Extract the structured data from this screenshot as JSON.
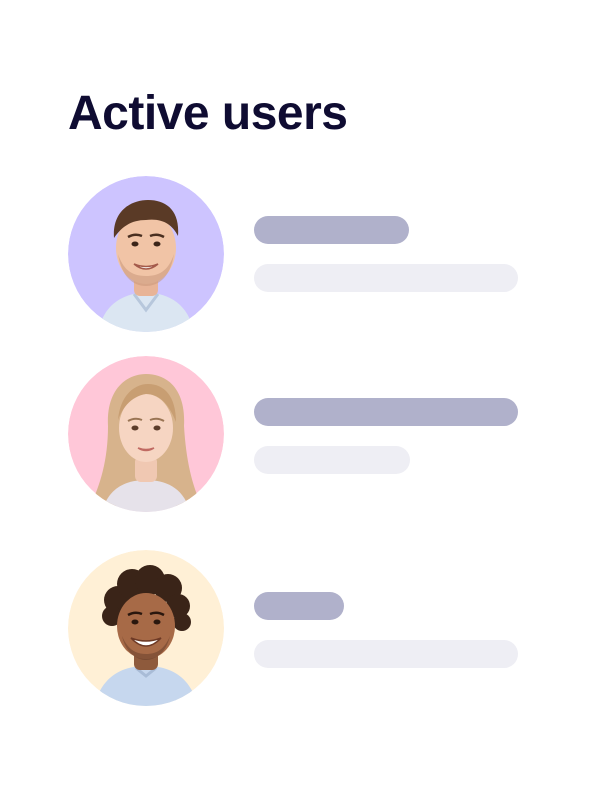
{
  "header": {
    "title": "Active users"
  },
  "users": [
    {
      "avatar_bg": "#cdc4ff",
      "avatar_icon": "user-avatar-man-icon"
    },
    {
      "avatar_bg": "#ffc7d8",
      "avatar_icon": "user-avatar-woman-icon"
    },
    {
      "avatar_bg": "#fff0d6",
      "avatar_icon": "user-avatar-man-curly-icon"
    }
  ],
  "colors": {
    "title": "#0f0c32",
    "name_placeholder": "#b0b1cb",
    "detail_placeholder": "#eeeef4"
  }
}
